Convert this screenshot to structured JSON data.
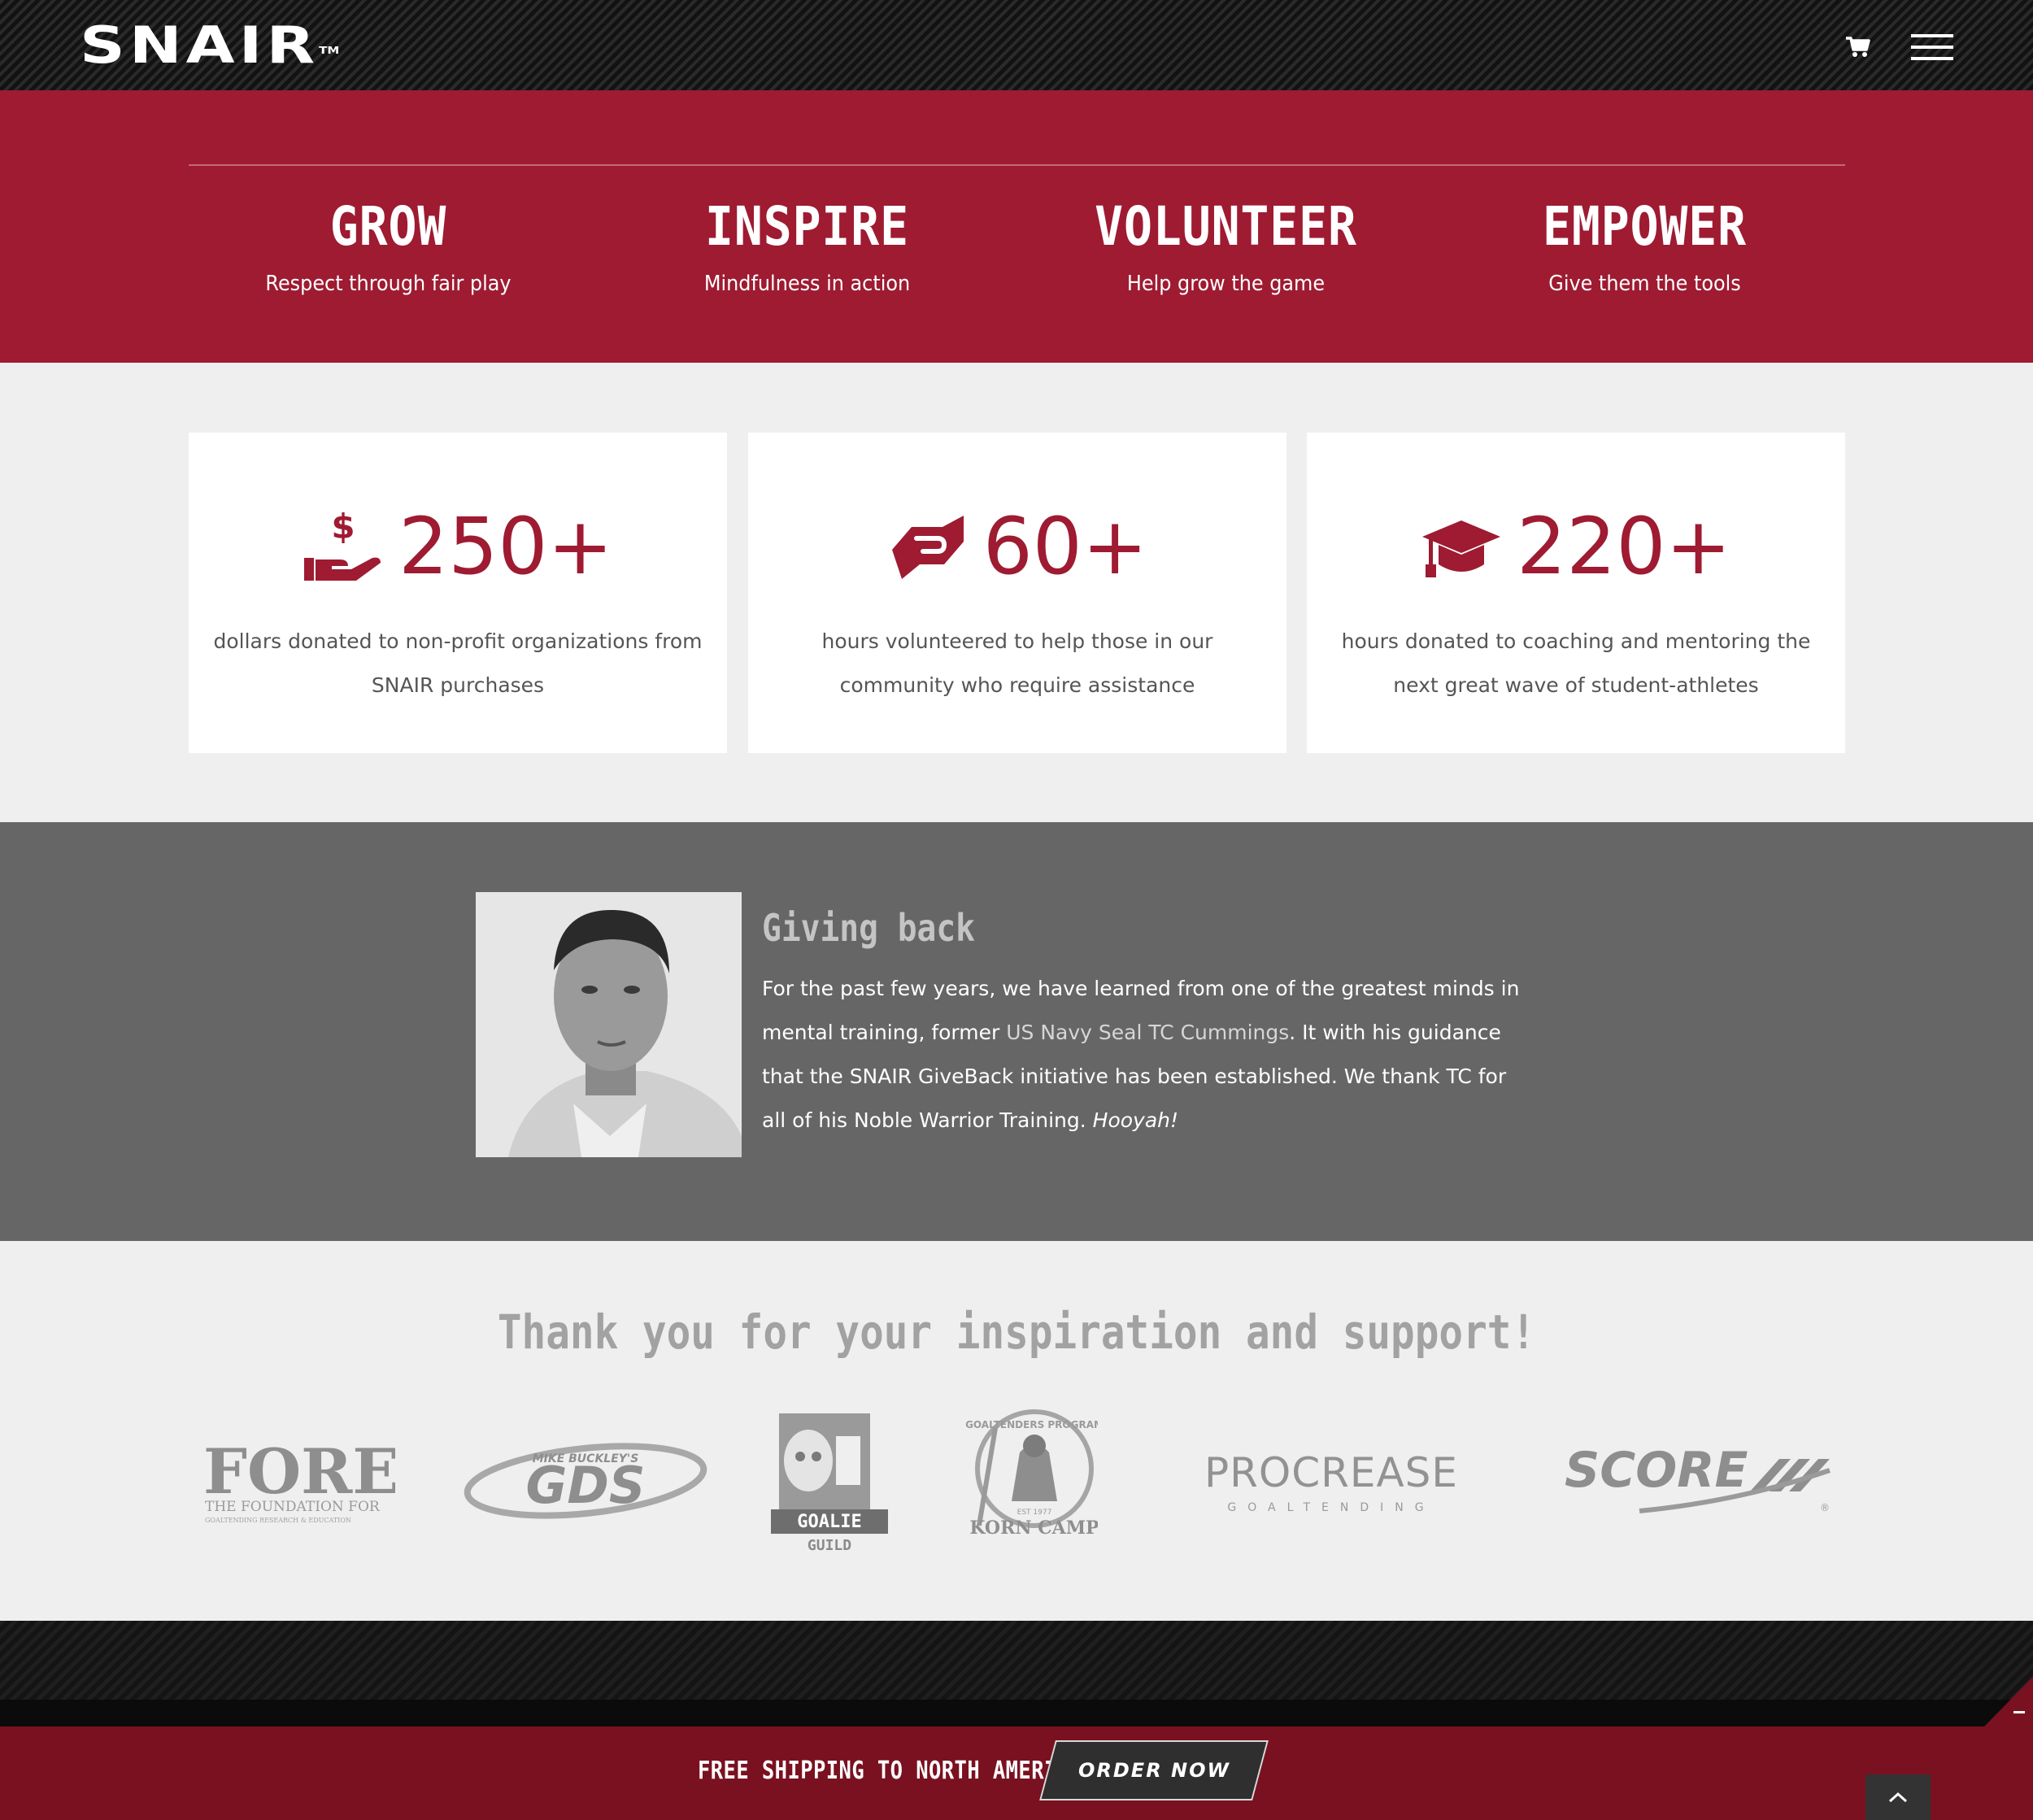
{
  "header": {
    "logo_text": "SNAIR",
    "logo_tm": "TM",
    "icons": {
      "cart": "cart-icon",
      "menu": "hamburger-menu-icon"
    }
  },
  "values": [
    {
      "title": "GROW",
      "subtitle": "Respect through fair play"
    },
    {
      "title": "INSPIRE",
      "subtitle": "Mindfulness in action"
    },
    {
      "title": "VOLUNTEER",
      "subtitle": "Help grow the game"
    },
    {
      "title": "EMPOWER",
      "subtitle": "Give them the tools"
    }
  ],
  "stats": [
    {
      "icon": "dollar-hand-icon",
      "number": "250+",
      "description": "dollars donated to non-profit organizations from SNAIR purchases"
    },
    {
      "icon": "handshake-icon",
      "number": "60+",
      "description": "hours volunteered to help those in our community who require assistance"
    },
    {
      "icon": "graduation-cap-icon",
      "number": "220+",
      "description": "hours donated to coaching and mentoring the next great wave of student-athletes"
    }
  ],
  "giving": {
    "title": "Giving back",
    "text_1": "For the past few years, we have learned from one of the greatest minds in mental training, former ",
    "link": "US Navy Seal TC Cummings",
    "text_2": ". It with his guidance that the SNAIR GiveBack initiative has been established. We thank TC for all of his Noble Warrior Training. ",
    "emphasis": "Hooyah!"
  },
  "thanks": {
    "title": "Thank you for your inspiration and support!",
    "partners": [
      {
        "name": "FORE",
        "line1": "THE FOUNDATION FOR",
        "line2": "GOALTENDING RESEARCH & EDUCATION"
      },
      {
        "name": "GDS",
        "line1": "MIKE BUCKLEY'S"
      },
      {
        "name": "GOALIE",
        "line1": "GUILD"
      },
      {
        "name": "KORN CAMP",
        "line1": "GOALTENDERS PROGRAM",
        "line2": "EST 1977"
      },
      {
        "name": "PROCREASE",
        "line1": "GOALTENDING"
      },
      {
        "name": "SCORE",
        "line1": "®"
      }
    ]
  },
  "footer": {
    "shipping_text": "FREE SHIPPING TO NORTH AMERICA",
    "order_button": "ORDER NOW"
  },
  "colors": {
    "brand_red": "#9e1b32",
    "bar_red": "#7a1120",
    "gray_band": "#666666"
  }
}
